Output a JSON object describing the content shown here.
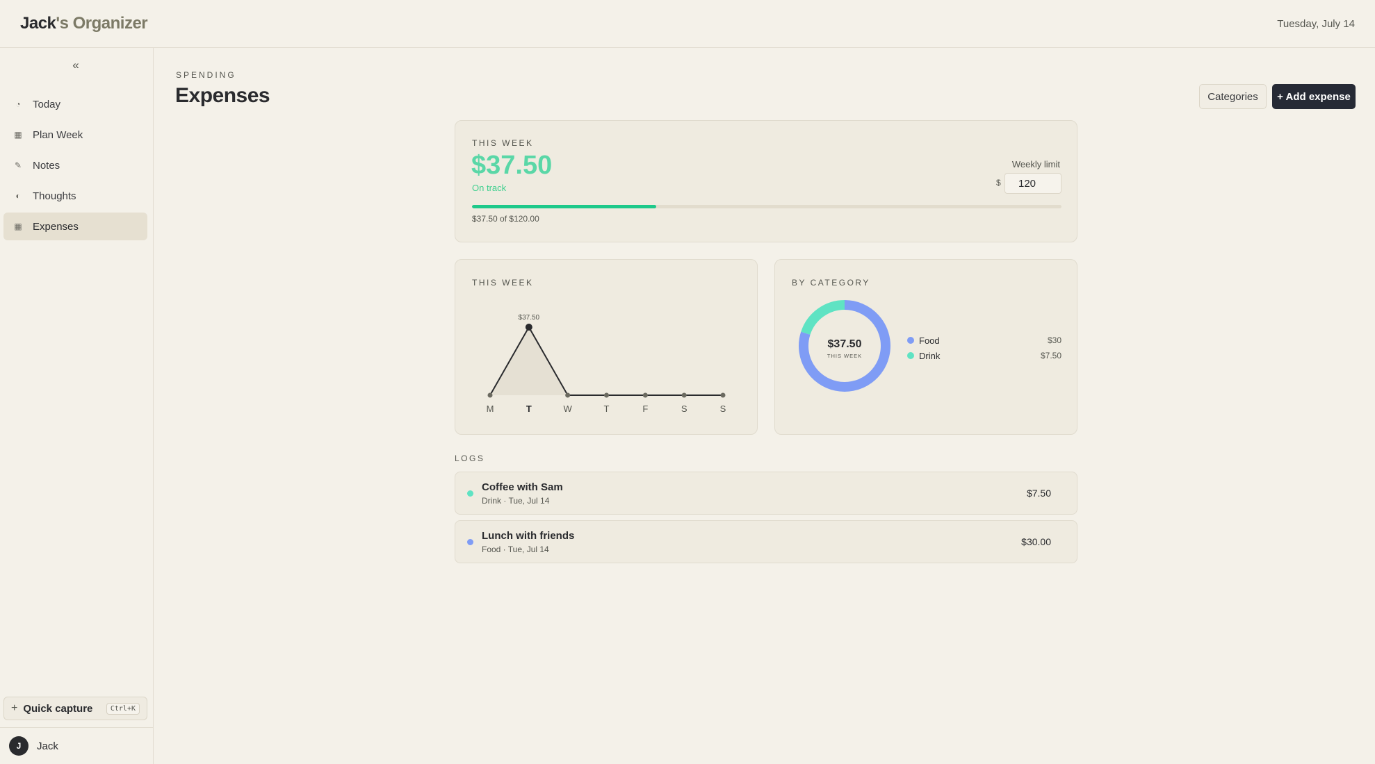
{
  "app": {
    "owner": "Jack",
    "title_rest": "'s Organizer",
    "date": "Tuesday, July 14"
  },
  "sidebar": {
    "collapse_glyph": "«",
    "items": [
      {
        "label": "Today",
        "icon": "clock-icon",
        "glyph": "◔",
        "active": false
      },
      {
        "label": "Plan Week",
        "icon": "calendar-grid-icon",
        "glyph": "▦",
        "active": false
      },
      {
        "label": "Notes",
        "icon": "pencil-icon",
        "glyph": "✎",
        "active": false
      },
      {
        "label": "Thoughts",
        "icon": "half-circle-icon",
        "glyph": "◐",
        "active": false
      },
      {
        "label": "Expenses",
        "icon": "ledger-grid-icon",
        "glyph": "▦",
        "active": true
      }
    ],
    "quick_capture": {
      "label": "Quick capture",
      "shortcut": "Ctrl+K"
    },
    "user": {
      "initial": "J",
      "name": "Jack"
    }
  },
  "header": {
    "eyebrow": "SPENDING",
    "title": "Expenses",
    "categories_button": "Categories",
    "add_button": "+ Add expense"
  },
  "summary": {
    "label": "THIS WEEK",
    "amount": "$37.50",
    "status": "On track",
    "limit_label": "Weekly limit",
    "currency": "$",
    "limit_value": "120",
    "progress": 0.3125,
    "caption": "$37.50 of $120.00",
    "accent_color": "#5ad7a7",
    "progress_color": "#1ec98a"
  },
  "week_chart": {
    "label": "THIS WEEK"
  },
  "category": {
    "label": "BY CATEGORY",
    "center_amount": "$37.50",
    "center_caption": "THIS WEEK",
    "items": [
      {
        "name": "Food",
        "value": "$30",
        "color": "#7f9cf5"
      },
      {
        "name": "Drink",
        "value": "$7.50",
        "color": "#5fe3c3"
      }
    ]
  },
  "logs": {
    "label": "LOGS",
    "entries": [
      {
        "title": "Coffee with Sam",
        "meta": "Drink · Tue, Jul 14",
        "amount": "$7.50",
        "color": "#5fe3c3"
      },
      {
        "title": "Lunch with friends",
        "meta": "Food · Tue, Jul 14",
        "amount": "$30.00",
        "color": "#7f9cf5"
      }
    ]
  },
  "chart_data": [
    {
      "type": "line",
      "title": "THIS WEEK",
      "categories": [
        "M",
        "T",
        "W",
        "T",
        "F",
        "S",
        "S"
      ],
      "values": [
        0,
        37.5,
        0,
        0,
        0,
        0,
        0
      ],
      "highlight_index": 1,
      "data_labels": [
        {
          "index": 1,
          "text": "$37.50"
        }
      ],
      "xlabel": "",
      "ylabel": "",
      "grid": false
    },
    {
      "type": "pie",
      "title": "BY CATEGORY",
      "categories": [
        "Food",
        "Drink"
      ],
      "values": [
        30,
        7.5
      ],
      "colors": [
        "#7f9cf5",
        "#5fe3c3"
      ],
      "center_text": "$37.50",
      "center_subtext": "THIS WEEK"
    }
  ]
}
